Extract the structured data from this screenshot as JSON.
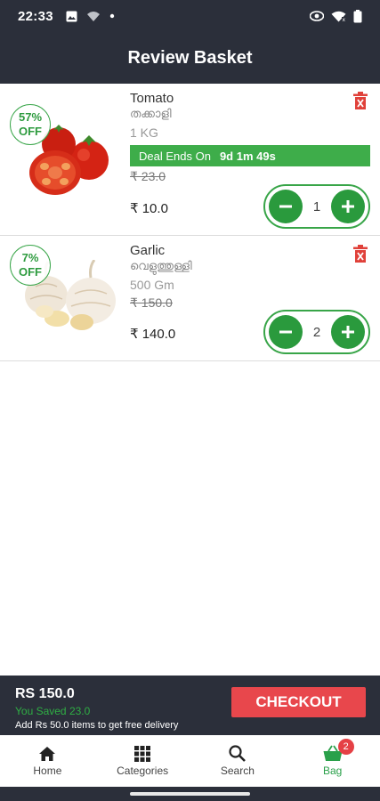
{
  "status_bar": {
    "time": "22:33"
  },
  "header": {
    "title": "Review Basket"
  },
  "items": [
    {
      "name": "Tomato",
      "local_name": "തക്കാളി",
      "unit": "1 KG",
      "discount_pct": "57%",
      "discount_off": "OFF",
      "deal_label": "Deal Ends On",
      "deal_time": "9d 1m 49s",
      "old_price": "₹ 23.0",
      "price": "₹ 10.0",
      "quantity": "1"
    },
    {
      "name": "Garlic",
      "local_name": "വെളുത്തുള്ളി",
      "unit": "500 Gm",
      "discount_pct": "7%",
      "discount_off": "OFF",
      "old_price": "₹ 150.0",
      "price": "₹ 140.0",
      "quantity": "2"
    }
  ],
  "summary": {
    "total": "RS 150.0",
    "saved": "You Saved 23.0",
    "free_delivery_note": "Add Rs 50.0 items to get free delivery",
    "checkout_label": "CHECKOUT"
  },
  "bottom_nav": {
    "home": "Home",
    "categories": "Categories",
    "search": "Search",
    "bag": "Bag",
    "bag_count": "2"
  },
  "colors": {
    "header_bg": "#2b2f3a",
    "accent_green": "#2a9a3d",
    "checkout_red": "#e8474c",
    "delete_red": "#e0413a"
  },
  "icons": [
    "image-icon",
    "wifi-icon",
    "eye-icon",
    "battery-icon",
    "delete-icon",
    "minus-icon",
    "plus-icon",
    "home-icon",
    "grid-icon",
    "search-icon",
    "basket-icon"
  ]
}
